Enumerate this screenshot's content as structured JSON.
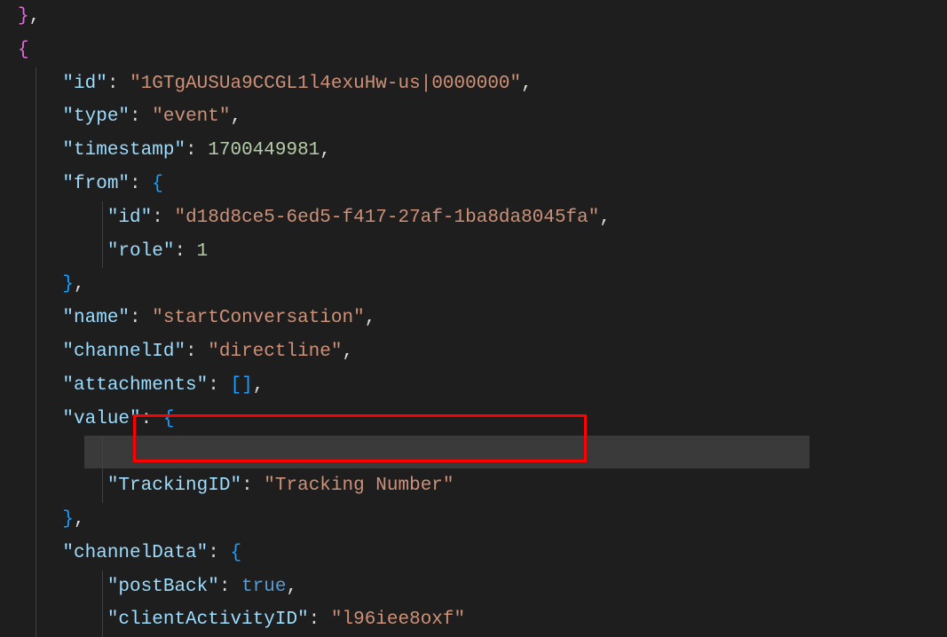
{
  "lines": {
    "l0_brace": "}",
    "l0_comma": ",",
    "l1_brace": "{",
    "l2_key": "\"id\"",
    "l2_val": "\"1GTgAUSUa9CCGL1l4exuHw-us|0000000\"",
    "l3_key": "\"type\"",
    "l3_val": "\"event\"",
    "l4_key": "\"timestamp\"",
    "l4_val": "1700449981",
    "l5_key": "\"from\"",
    "l5_brace": "{",
    "l6_key": "\"id\"",
    "l6_val": "\"d18d8ce5-6ed5-f417-27af-1ba8da8045fa\"",
    "l7_key": "\"role\"",
    "l7_val": "1",
    "l8_brace": "}",
    "l9_key": "\"name\"",
    "l9_val": "\"startConversation\"",
    "l10_key": "\"channelId\"",
    "l10_val": "\"directline\"",
    "l11_key": "\"attachments\"",
    "l11_open": "[",
    "l11_close": "]",
    "l12_key": "\"value\"",
    "l12_brace": "{",
    "l14_key": "\"TrackingID\"",
    "l14_val": "\"Tracking Number\"",
    "l15_brace": "}",
    "l16_key": "\"channelData\"",
    "l16_brace": "{",
    "l17_key": "\"postBack\"",
    "l17_val": "true",
    "l18_key": "\"clientActivityID\"",
    "l18_val": "\"l96iee8oxf\""
  }
}
